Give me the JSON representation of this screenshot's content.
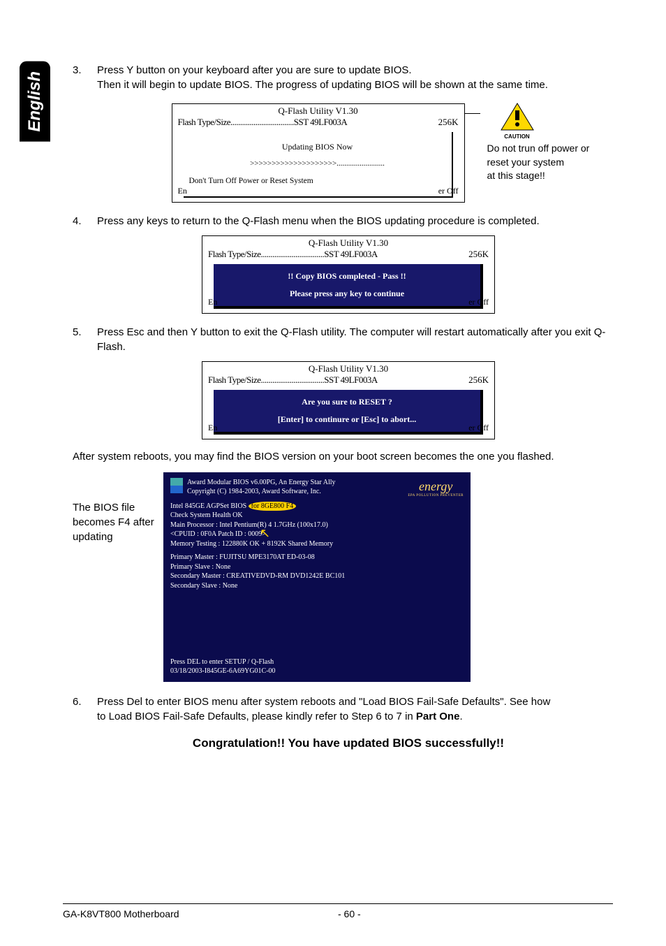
{
  "sideTab": "English",
  "steps": {
    "s3": {
      "num": "3.",
      "line1": "Press Y button on your keyboard after you are sure to update BIOS.",
      "line2": "Then it will begin to update BIOS. The progress of updating BIOS will be shown at the same time."
    },
    "s4": {
      "num": "4.",
      "text": "Press any keys to return to the Q-Flash menu when the BIOS updating procedure is completed."
    },
    "s5": {
      "num": "5.",
      "text": "Press Esc and then Y button to exit the Q-Flash utility. The computer will restart automatically after you exit Q-Flash."
    },
    "s6": {
      "num": "6.",
      "line1": "Press Del to enter BIOS menu after system reboots and \"Load BIOS Fail-Safe Defaults\". See how",
      "line2a": "to Load BIOS Fail-Safe Defaults, please kindly refer to Step 6 to 7 in ",
      "line2b": "Part One",
      "line2c": "."
    }
  },
  "qflash": {
    "title": "Q-Flash Utility V1.30",
    "typeLabel": "Flash Type/Size.................................SST 49LF003A",
    "size": "256K",
    "footerLeft": "En",
    "footerRight": "er Off",
    "box1": {
      "msg": "Updating BIOS Now",
      "progress": ">>>>>>>>>>>>>>>>>>>>.........................",
      "dont": "Don't Turn Off Power or Reset System"
    },
    "box2": {
      "msg": "!! Copy BIOS completed - Pass !!",
      "sub": "Please press any key to continue"
    },
    "box3": {
      "msg": "Are you sure to RESET ?",
      "sub": "[Enter] to continure or [Esc] to abort..."
    }
  },
  "caution": {
    "label": "CAUTION",
    "line1": "Do not trun off power or",
    "line2": "reset your system",
    "line3": "at this stage!!"
  },
  "afterText": "After system reboots, you may find the BIOS version on your boot screen becomes the one you flashed.",
  "bootLabel": "The BIOS file becomes F4 after updating",
  "boot": {
    "h1": "Award Modular BIOS v6.00PG, An Energy Star Ally",
    "h2": "Copyright  (C) 1984-2003, Award Software,  Inc.",
    "l1a": "Intel 845GE AGPSet BIOS ",
    "l1b": "for 8GE800 F4",
    "l2": "Check System Health OK",
    "l3": "Main Processor : Intel Pentium(R) 4   1.7GHz (100x17.0)",
    "l4": "<CPUID : 0F0A Patch ID  : 0009>",
    "l5": "Memory Testing   :  122880K OK + 8192K Shared Memory",
    "l6": "Primary Master : FUJITSU MPE3170AT ED-03-08",
    "l7": "Primary Slave : None",
    "l8": "Secondary Master : CREATIVEDVD-RM DVD1242E BC101",
    "l9": "Secondary Slave : None",
    "b1": "Press DEL to enter SETUP / Q-Flash",
    "b2": "03/18/2003-I845GE-6A69YG01C-00",
    "energy": "energy",
    "epa": "EPA  POLLUTION PREVENTER"
  },
  "congrats": "Congratulation!! You have updated BIOS successfully!!",
  "footer": {
    "left": "GA-K8VT800 Motherboard",
    "center": "- 60 -"
  }
}
